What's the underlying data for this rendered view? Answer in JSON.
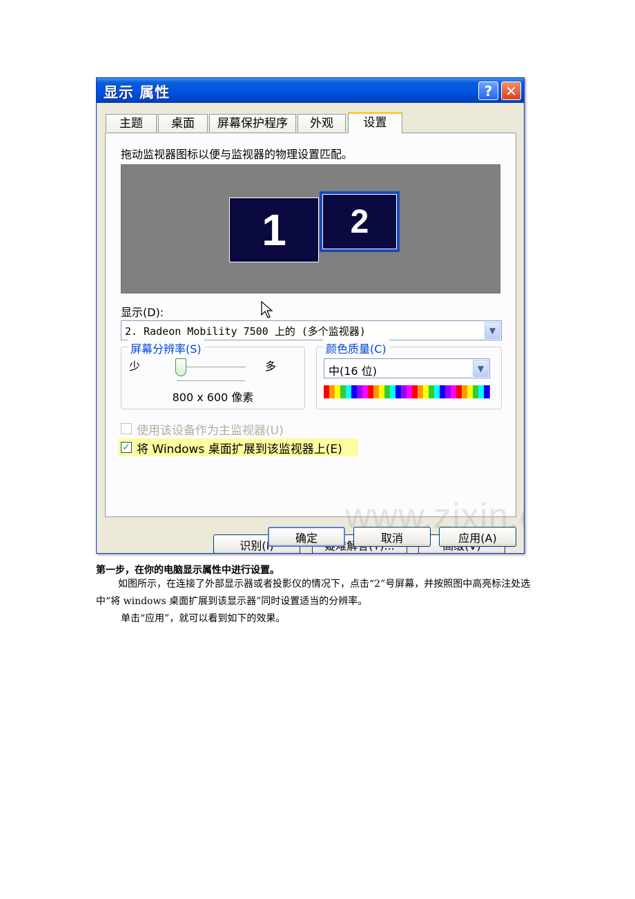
{
  "dialog": {
    "title": "显示 属性",
    "help_label": "?",
    "close_label": "✕",
    "tabs": [
      {
        "label": "主题"
      },
      {
        "label": "桌面"
      },
      {
        "label": "屏幕保护程序"
      },
      {
        "label": "外观"
      },
      {
        "label": "设置",
        "active": true
      }
    ],
    "instruction": "拖动监视器图标以便与监视器的物理设置匹配。",
    "monitors": [
      {
        "label": "1"
      },
      {
        "label": "2",
        "selected": true
      }
    ],
    "display_label": "显示(D):",
    "display_value": "2. Radeon Mobility 7500 上的 (多个监视器)",
    "resolution": {
      "title": "屏幕分辨率(S)",
      "min_label": "少",
      "max_label": "多",
      "value": "800 x 600 像素",
      "slider_position": 0.08
    },
    "color_quality": {
      "title": "颜色质量(C)",
      "value": "中(16 位)"
    },
    "primary_checkbox": {
      "label": "使用该设备作为主监视器(U)",
      "checked": false,
      "disabled": true
    },
    "extend_checkbox": {
      "label": "将 Windows 桌面扩展到该监视器上(E)",
      "checked": true
    },
    "buttons": {
      "identify": "识别(I)",
      "troubleshoot": "疑难解答(T)...",
      "advanced": "高级(V)",
      "ok": "确定",
      "cancel": "取消",
      "apply": "应用(A)"
    },
    "watermark": "www.zixin.com.cn",
    "colors": {
      "title_bar": "#0054e3",
      "monitor_fill": "#0a0a40",
      "desktop_gray": "#808080",
      "group_title": "#0046d5"
    }
  },
  "article": {
    "step_title": "第一步，在你的电脑显示属性中进行设置。",
    "paragraph1": "如图所示，在连接了外部显示器或者投影仪的情况下，点击“2”号屏幕，并按照图中高亮标注处选中“将 windows 桌面扩展到该显示器”同时设置适当的分辨率。",
    "paragraph2": "单击“应用”，就可以看到如下的效果。"
  }
}
